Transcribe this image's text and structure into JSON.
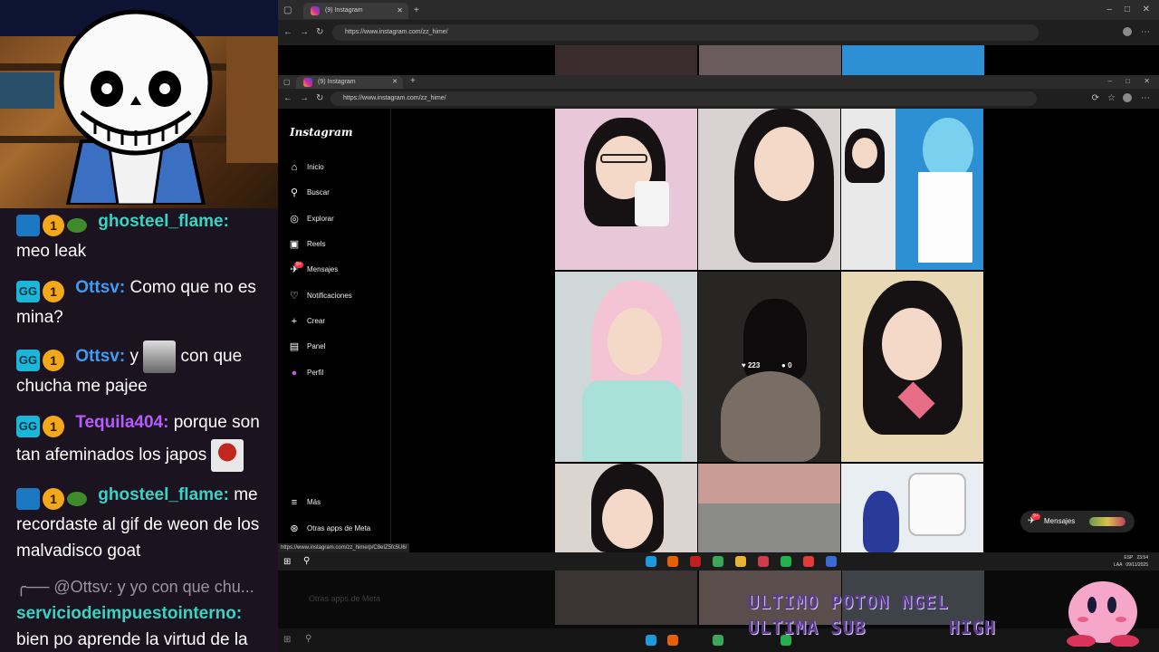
{
  "chat": [
    {
      "badges": [
        "mod",
        "one",
        "frog"
      ],
      "user": "ghosteel_flame:",
      "user_color": "#38d3c4",
      "text": "meo leak"
    },
    {
      "badges": [
        "g",
        "one"
      ],
      "user": "Ottsv:",
      "user_color": "#3f9cf5",
      "text": "Como que no es mina?"
    },
    {
      "badges": [
        "g",
        "one"
      ],
      "user": "Ottsv:",
      "user_color": "#3f9cf5",
      "text_pre": "y",
      "text": "con que chucha me pajee"
    },
    {
      "badges": [
        "g",
        "one"
      ],
      "user": "Tequila404:",
      "user_color": "#b45cff",
      "text": "porque son tan afeminados los japos"
    },
    {
      "badges": [
        "mod",
        "one",
        "frog"
      ],
      "user": "ghosteel_flame:",
      "user_color": "#38d3c4",
      "text": "me recordaste al gif de weon de los malvadisco goat"
    },
    {
      "reply": "@Ottsv: y yo con que chu..."
    },
    {
      "badges": [],
      "user": "serviciodeimpuestointerno:",
      "user_color": "#38d3c4",
      "text": "bien po aprende la virtud de la homosexualidad"
    }
  ],
  "badge_labels": {
    "one": "1",
    "g": "GG"
  },
  "outer_browser": {
    "tab_title": "(9) Instagram",
    "url": "https://www.instagram.com/zz_hime/"
  },
  "inner_browser": {
    "tab_title": "(9) Instagram",
    "url": "https://www.instagram.com/zz_hime/"
  },
  "instagram": {
    "logo": "Instagram",
    "nav": [
      {
        "label": "Inicio",
        "icon": "home-icon",
        "glyph": "⌂"
      },
      {
        "label": "Buscar",
        "icon": "search-icon",
        "glyph": "⚲"
      },
      {
        "label": "Explorar",
        "icon": "compass-icon",
        "glyph": "◎"
      },
      {
        "label": "Reels",
        "icon": "reels-icon",
        "glyph": "▣"
      },
      {
        "label": "Mensajes",
        "icon": "messenger-icon",
        "glyph": "✈",
        "badge": "9+"
      },
      {
        "label": "Notificaciones",
        "icon": "heart-icon",
        "glyph": "♡"
      },
      {
        "label": "Crear",
        "icon": "plus-icon",
        "glyph": "+"
      },
      {
        "label": "Panel",
        "icon": "dashboard-icon",
        "glyph": "▤"
      },
      {
        "label": "Perfil",
        "icon": "avatar-icon",
        "glyph": "●"
      }
    ],
    "nav_bottom": [
      {
        "label": "Más",
        "icon": "menu-icon",
        "glyph": "≡"
      },
      {
        "label": "Otras apps de Meta",
        "icon": "meta-icon",
        "glyph": "⊛"
      }
    ],
    "hover_stats": {
      "likes": "223",
      "comments": "0"
    },
    "messages_pill": {
      "label": "Mensajes",
      "badge": "9+"
    },
    "status_url": "https://www.instagram.com/zz_hime/p/C8eIZ5fc5U6/"
  },
  "tray": {
    "lang": "ESP",
    "lang2": "LAA",
    "time": "23:54",
    "date": "09/11/2025"
  },
  "overlay": {
    "sub_line1": "ULTIMO POTON",
    "sub_line2": "ULTIMA SUB",
    "name_line1": "NGEL",
    "name_line2": "HIGH"
  },
  "lower_ghost": {
    "label": "Otras apps de Meta"
  }
}
